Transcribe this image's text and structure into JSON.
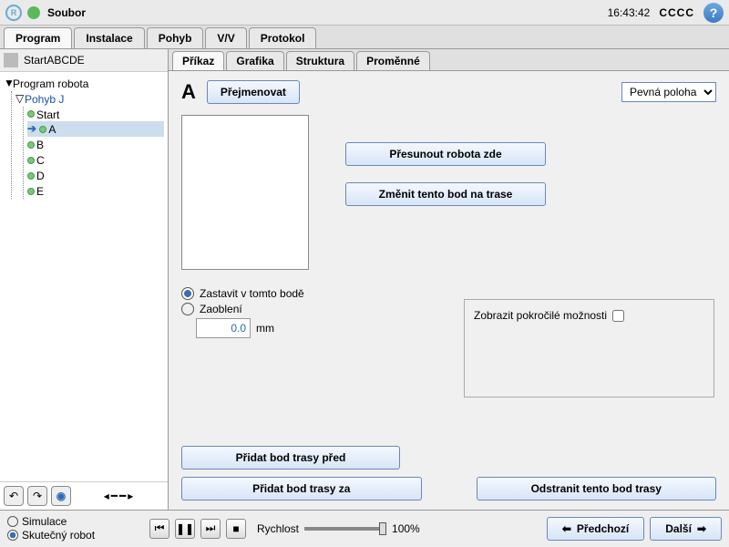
{
  "topbar": {
    "menu": "Soubor",
    "clock": "16:43:42",
    "cccc": "CCCC"
  },
  "maintabs": [
    "Program",
    "Instalace",
    "Pohyb",
    "V/V",
    "Protokol"
  ],
  "file": "StartABCDE",
  "tree": {
    "root": "Program robota",
    "move": "Pohyb J",
    "points": [
      "Start",
      "A",
      "B",
      "C",
      "D",
      "E"
    ]
  },
  "subtabs": [
    "Příkaz",
    "Grafika",
    "Struktura",
    "Proměnné"
  ],
  "panel": {
    "letter": "A",
    "rename": "Přejmenovat",
    "positionSelect": "Pevná poloha",
    "moveRobot": "Přesunout robota zde",
    "changePoint": "Změnit tento bod na trase",
    "advanced": "Zobrazit pokročilé možnosti",
    "stopHere": "Zastavit v tomto bodě",
    "blend": "Zaoblení",
    "blendVal": "0.0",
    "blendUnit": "mm",
    "addBefore": "Přidat bod trasy před",
    "addAfter": "Přidat bod trasy za",
    "remove": "Odstranit tento bod trasy"
  },
  "footer": {
    "sim": "Simulace",
    "real": "Skutečný robot",
    "speed": "Rychlost",
    "pct": "100%",
    "prev": "Předchozí",
    "next": "Další"
  },
  "nav": {
    "arrows": "◂━━▸"
  }
}
